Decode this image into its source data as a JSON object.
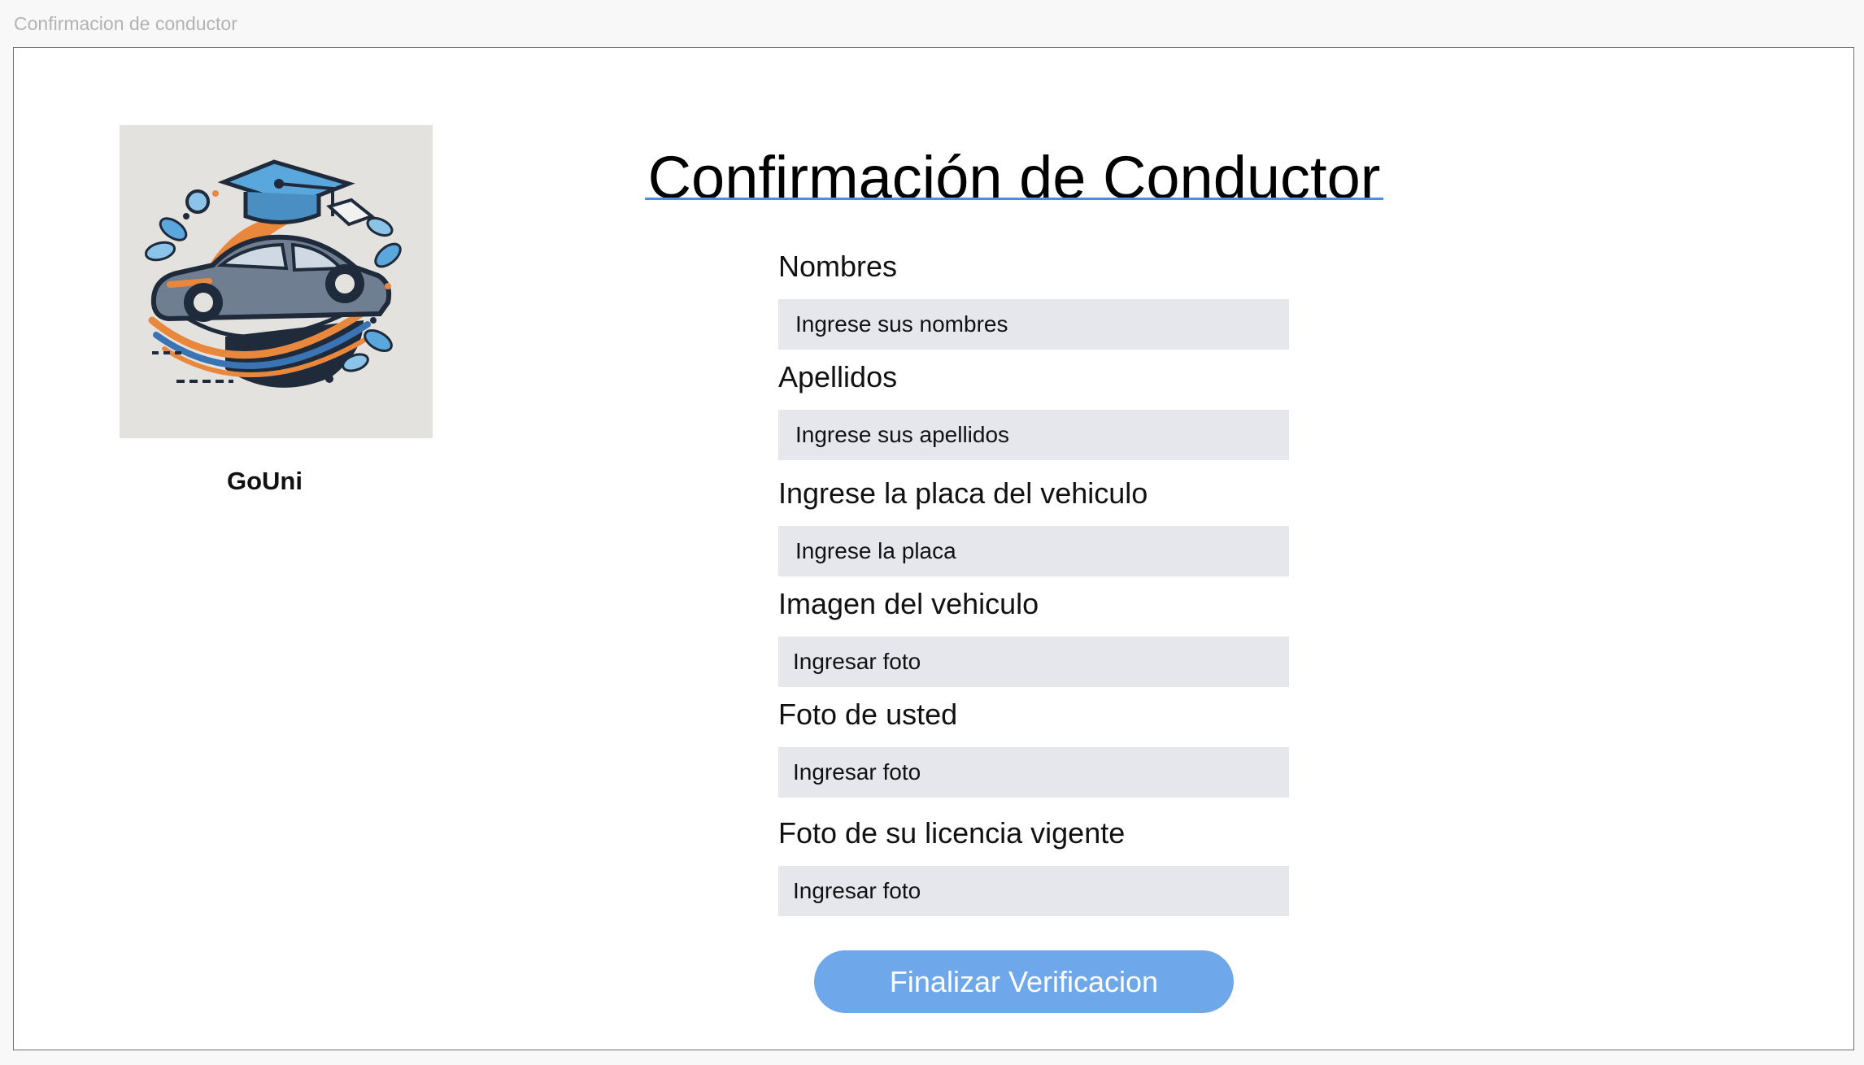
{
  "window": {
    "title": "Confirmacion de conductor"
  },
  "brand": {
    "name": "GoUni",
    "logo_icon": "car-graduation-cap-logo"
  },
  "page": {
    "title": "Confirmación de Conductor",
    "accent_color": "#4a90e2"
  },
  "form": {
    "nombres": {
      "label": "Nombres",
      "placeholder": "Ingrese sus nombres"
    },
    "apellidos": {
      "label": "Apellidos",
      "placeholder": "Ingrese sus apellidos"
    },
    "placa": {
      "label": "Ingrese la placa del vehiculo",
      "placeholder": "Ingrese la placa"
    },
    "imagen_vehiculo": {
      "label": "Imagen del vehiculo",
      "button": "Ingresar foto"
    },
    "foto_usted": {
      "label": "Foto de usted",
      "button": "Ingresar foto"
    },
    "foto_licencia": {
      "label": "Foto de su licencia vigente",
      "button": "Ingresar foto"
    },
    "submit_label": "Finalizar Verificacion"
  },
  "colors": {
    "field_bg": "#e6e7ec",
    "button_bg": "#6ea8ea"
  }
}
